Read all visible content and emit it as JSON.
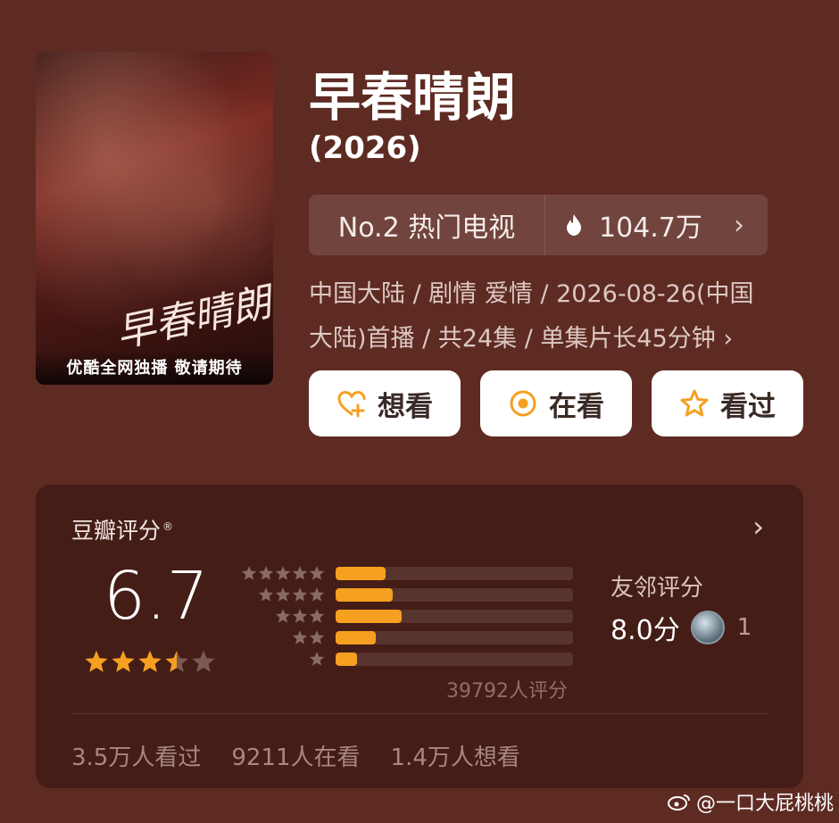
{
  "poster": {
    "script_text": "早春晴朗",
    "banner_text": "优酷全网独播 敬请期待"
  },
  "show": {
    "title": "早春晴朗",
    "year": "(2026)"
  },
  "ranking": {
    "label": "No.2 热门电视",
    "heat": "104.7万",
    "chevron": "›"
  },
  "meta": {
    "line1": "中国大陆 / 剧情 爱情 / 2026-08-26(中国",
    "line2": "大陆)首播 / 共24集 / 单集片长45分钟 ›"
  },
  "actions": {
    "want": "想看",
    "watching": "在看",
    "watched": "看过"
  },
  "rating": {
    "source": "豆瓣评分",
    "reg": "®",
    "chevron": "›",
    "score": "6.7",
    "stars": 3.5,
    "distribution": [
      0.21,
      0.24,
      0.28,
      0.17,
      0.09
    ],
    "total": "39792人评分",
    "accent": "#f5a020"
  },
  "friends": {
    "label": "友邻评分",
    "score": "8.0分",
    "count": "1"
  },
  "stats": {
    "watched": "3.5万人看过",
    "watching": "9211人在看",
    "want": "1.4万人想看"
  },
  "watermark": {
    "text": "@一口大屁桃桃"
  }
}
